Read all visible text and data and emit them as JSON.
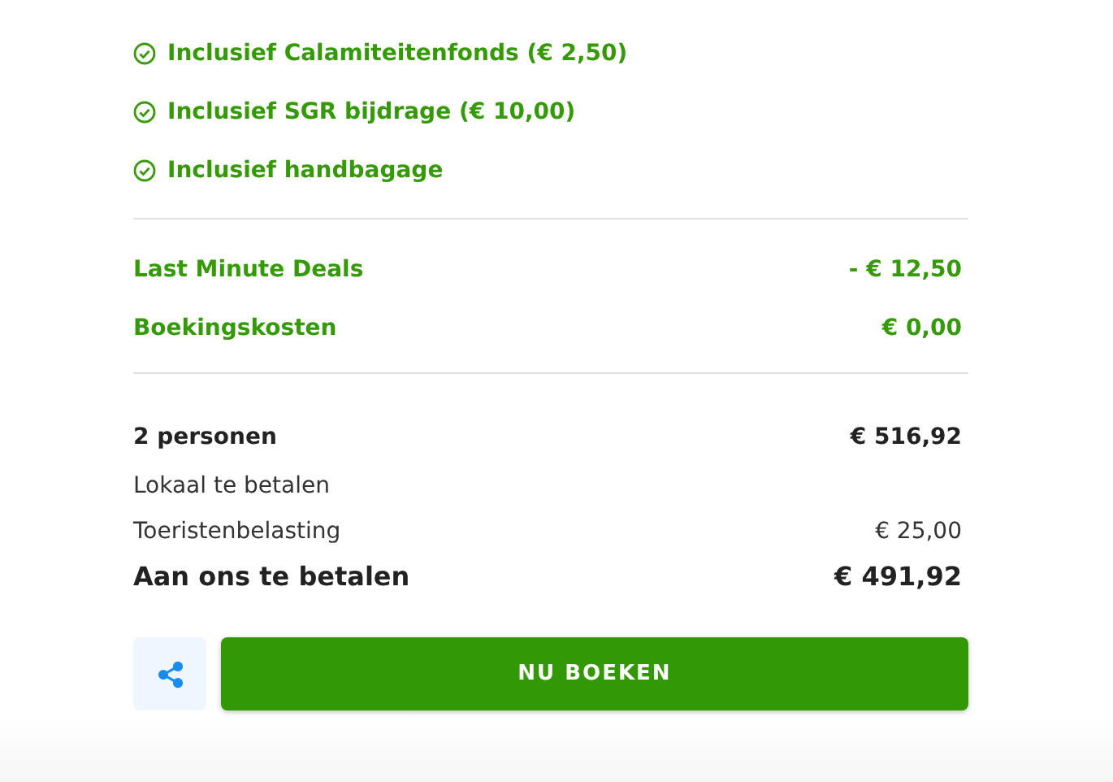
{
  "inclusions": [
    "Inclusief Calamiteitenfonds (€ 2,50)",
    "Inclusief SGR bijdrage (€ 10,00)",
    "Inclusief handbagage"
  ],
  "discounts": [
    {
      "label": "Last Minute Deals",
      "amount": "- € 12,50"
    },
    {
      "label": "Boekingskosten",
      "amount": "€ 0,00"
    }
  ],
  "summary": [
    {
      "kind": "bold",
      "label": "2 personen",
      "amount": "€ 516,92"
    },
    {
      "kind": "plain",
      "label": "Lokaal te betalen"
    },
    {
      "kind": "plain",
      "label": "Toeristenbelasting",
      "amount": "€ 25,00"
    },
    {
      "kind": "total",
      "label": "Aan ons te betalen",
      "amount": "€ 491,92"
    }
  ],
  "book_button": "NU BOEKEN"
}
